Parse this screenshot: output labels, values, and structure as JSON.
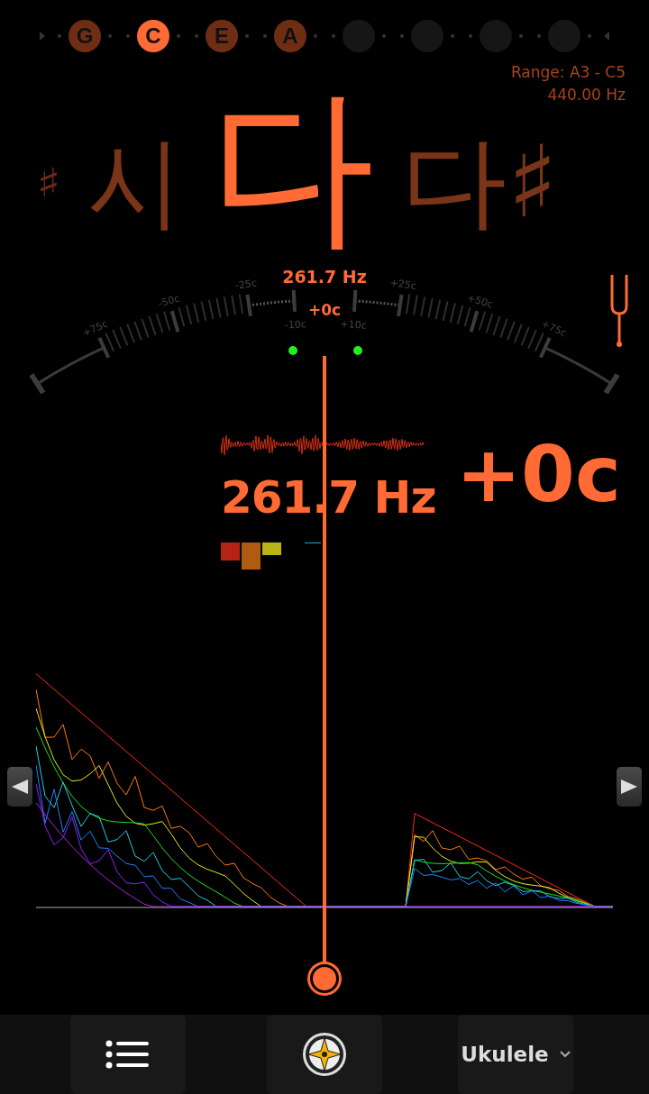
{
  "strings": [
    {
      "kind": "note",
      "label": "G",
      "selected": false
    },
    {
      "kind": "note",
      "label": "C",
      "selected": true
    },
    {
      "kind": "note",
      "label": "E",
      "selected": false
    },
    {
      "kind": "note",
      "label": "A",
      "selected": false
    },
    {
      "kind": "empty"
    },
    {
      "kind": "empty"
    },
    {
      "kind": "empty"
    },
    {
      "kind": "empty"
    }
  ],
  "range": {
    "text": "Range: A3 - C5",
    "reference": "440.00 Hz"
  },
  "notes": [
    {
      "label": "♯",
      "selected": false
    },
    {
      "label": "시",
      "selected": false
    },
    {
      "label": "다",
      "selected": true
    },
    {
      "label": "다♯",
      "selected": false
    }
  ],
  "meter": {
    "frequency": "261.7 Hz",
    "cents": "+0c",
    "tick_labels": [
      "+75c",
      "-50c",
      "-25c",
      "-10c",
      "+10c",
      "+25c",
      "+50c",
      "+75c"
    ],
    "in_tune": true
  },
  "readout": {
    "frequency": "261.7 Hz",
    "cents": "+0c"
  },
  "signal_blocks": [
    {
      "color": "#b52314"
    },
    {
      "color": "#b05a12"
    },
    {
      "color": "#b8b414"
    }
  ],
  "bottom_bar": {
    "instrument": "Ukulele"
  }
}
